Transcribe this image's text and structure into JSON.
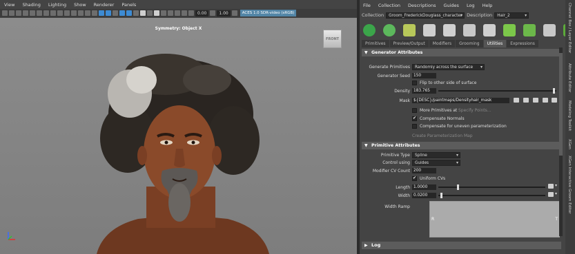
{
  "viewport": {
    "menu": [
      "View",
      "Shading",
      "Lighting",
      "Show",
      "Renderer",
      "Panels"
    ],
    "near_clip": "0.00",
    "far_clip": "1.00",
    "color_space": "ACES 1.0 SDR-video (sRGB)",
    "title": "Symmetry: Object X",
    "cube_label": "FRONT"
  },
  "xgen": {
    "menu": [
      "File",
      "Collection",
      "Descriptions",
      "Guides",
      "Log",
      "Help"
    ],
    "collection_label": "Collection",
    "collection_value": "Groom_FrederickDouglass_character",
    "description_label": "Description",
    "description_value": "Hair_2",
    "tabs": [
      "Primitives",
      "Preview/Output",
      "Modifiers",
      "Grooming",
      "Utilities",
      "Expressions"
    ],
    "active_tab": "Utilities",
    "generator": {
      "title": "Generator Attributes",
      "primitives_label": "Generate Primitives",
      "primitives_value": "Randomly across the surface",
      "seed_label": "Generator Seed",
      "seed_value": "150",
      "flip_label": "Flip to other side of surface",
      "density_label": "Density",
      "density_value": "183.765",
      "density_level": 0.99,
      "mask_label": "Mask",
      "mask_value": "${DESC}/paintmaps/Densityhair_mask",
      "more_label": "More Primitives at",
      "specify_label": "Specify Points...",
      "comp_normals_label": "Compensate Normals",
      "comp_param_label": "Compensate for uneven parameterization",
      "create_map_label": "Create Parameterization Map"
    },
    "primitive": {
      "title": "Primitive Attributes",
      "type_label": "Primitive Type",
      "type_value": "Spline",
      "control_label": "Control using",
      "control_value": "Guides",
      "cv_label": "Modifier CV Count",
      "cv_value": "200",
      "uniform_label": "Uniform CVs",
      "length_label": "Length",
      "length_value": "1.0000",
      "length_level": 0.18,
      "width_label": "Width",
      "width_value": "0.0200",
      "width_level": 0.02,
      "ramp_label": "Width Ramp",
      "ramp_left": "R",
      "ramp_right": "T"
    },
    "log_label": "Log"
  },
  "side_tabs": [
    "Channel Box / Layer Editor",
    "Attribute Editor",
    "Modeling Toolkit",
    "XGen",
    "XGen Interactive Groom Editor"
  ]
}
